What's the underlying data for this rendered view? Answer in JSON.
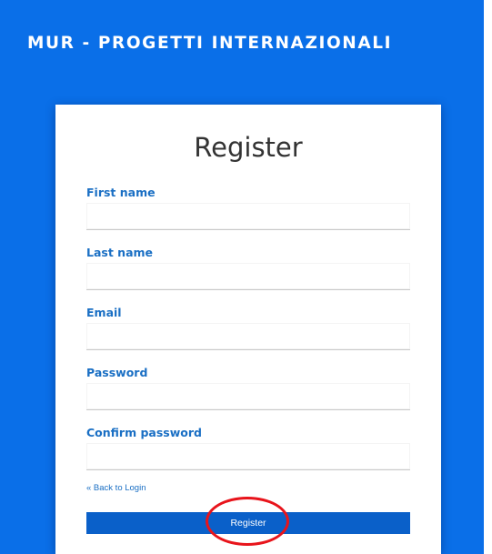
{
  "header": {
    "title": "MUR - PROGETTI INTERNAZIONALI"
  },
  "form": {
    "title": "Register",
    "fields": [
      {
        "label": "First name",
        "value": "",
        "placeholder": ""
      },
      {
        "label": "Last name",
        "value": "",
        "placeholder": ""
      },
      {
        "label": "Email",
        "value": "",
        "placeholder": ""
      },
      {
        "label": "Password",
        "value": "",
        "placeholder": ""
      },
      {
        "label": "Confirm password",
        "value": "",
        "placeholder": ""
      }
    ],
    "back_link": "« Back to Login",
    "submit_label": "Register"
  },
  "colors": {
    "page_background": "#0a6fe8",
    "label_text": "#1a6fc4",
    "button_background": "#0a60c9",
    "highlight_annotation": "#e8141b"
  }
}
